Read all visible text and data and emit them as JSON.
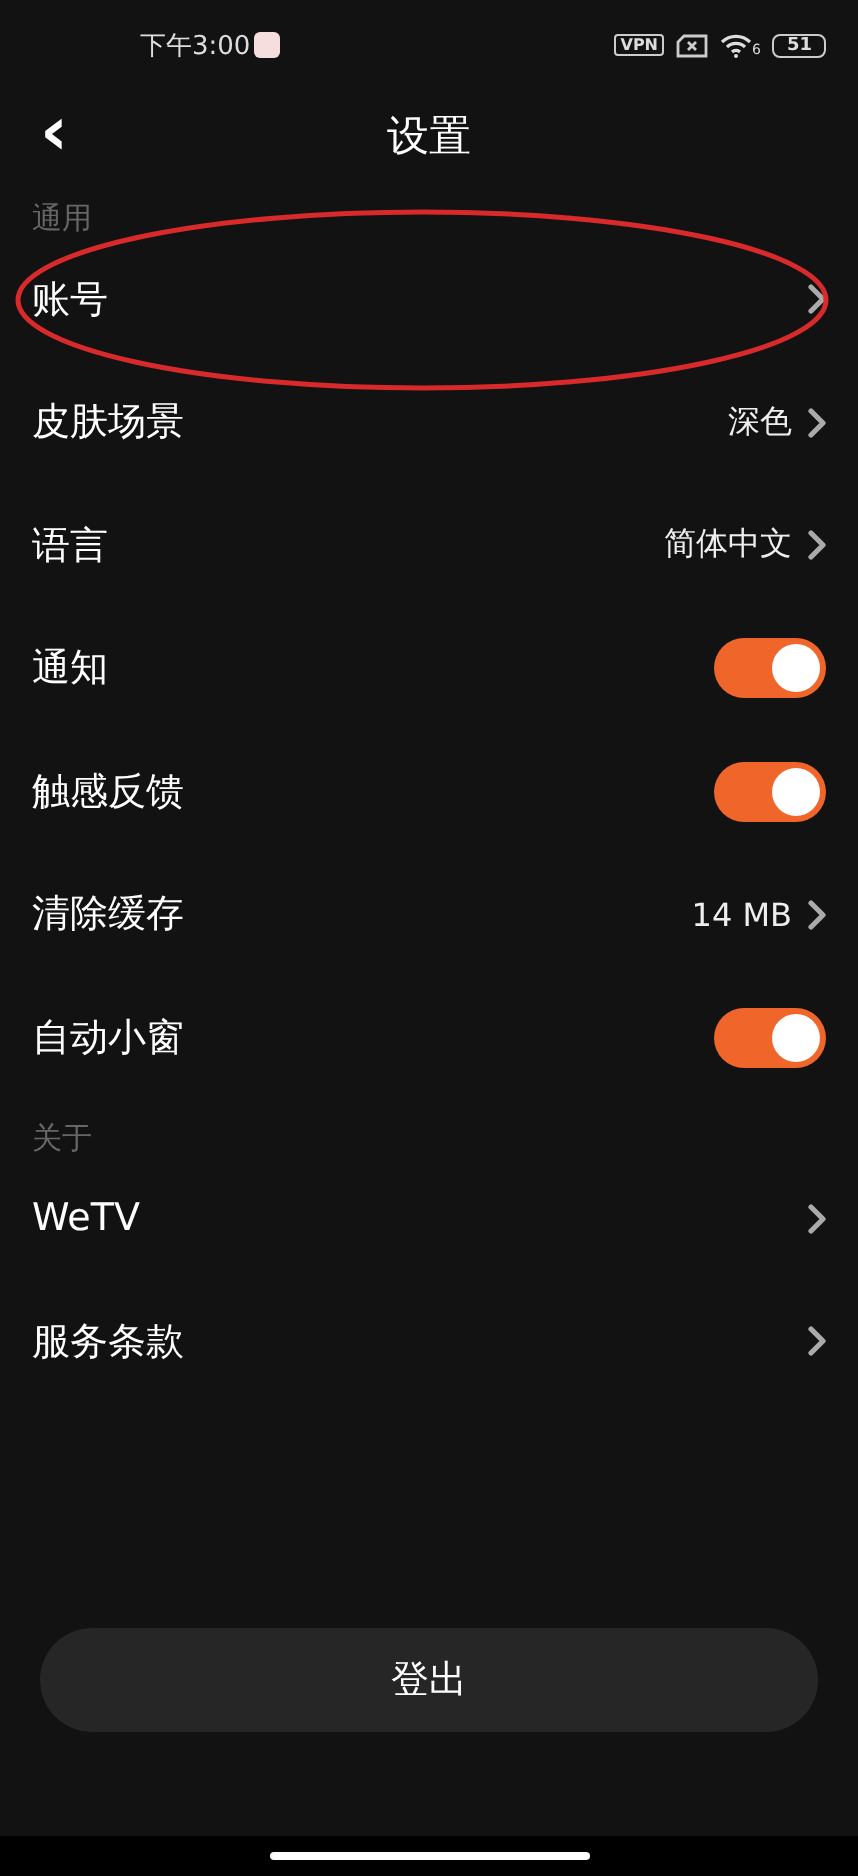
{
  "status_bar": {
    "time": "下午3:00",
    "vpn": "VPN",
    "wifi_badge": "6",
    "battery": "51"
  },
  "header": {
    "back": "‹",
    "title": "设置"
  },
  "sections": [
    {
      "title": "通用",
      "items": [
        {
          "kind": "link",
          "label": "账号",
          "circled": true
        },
        {
          "kind": "link",
          "label": "皮肤场景",
          "value": "深色",
          "circled": false
        },
        {
          "kind": "link",
          "label": "语言",
          "value": "简体中文",
          "circled": false
        },
        {
          "kind": "toggle",
          "label": "通知",
          "on": true,
          "circled": false
        },
        {
          "kind": "toggle",
          "label": "触感反馈",
          "on": true,
          "circled": false
        },
        {
          "kind": "link",
          "label": "清除缓存",
          "value": "14 MB",
          "circled": false
        },
        {
          "kind": "toggle",
          "label": "自动小窗",
          "on": true,
          "circled": false
        }
      ]
    },
    {
      "title": "关于",
      "items": [
        {
          "kind": "link",
          "label": "WeTV",
          "circled": false
        },
        {
          "kind": "link",
          "label": "服务条款",
          "circled": false
        }
      ]
    }
  ],
  "logout": "登出"
}
